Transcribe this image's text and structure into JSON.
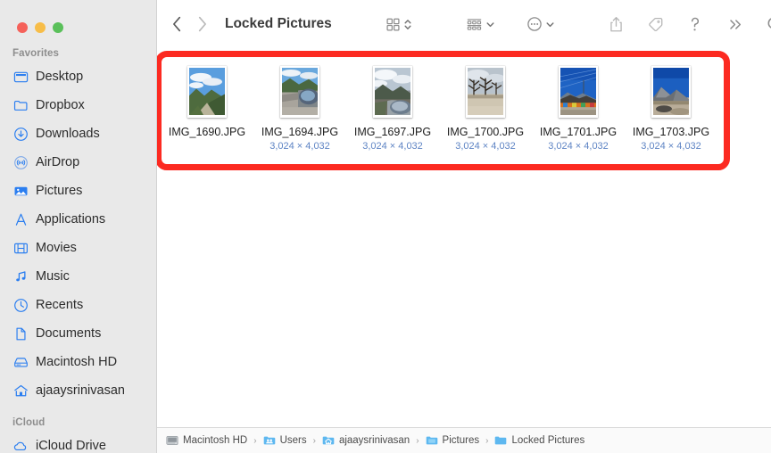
{
  "window": {
    "title": "Locked Pictures",
    "traffic_lights": [
      {
        "name": "close",
        "color": "#f5615a"
      },
      {
        "name": "minimize",
        "color": "#f7bd48"
      },
      {
        "name": "maximize",
        "color": "#5ac05a"
      }
    ]
  },
  "toolbar": {
    "back_icon": "chevron-left-icon",
    "forward_icon": "chevron-right-icon",
    "view_mode_icon": "icon-view-icon",
    "view_mode_chevron": "chevron-updown-icon",
    "group_by_icon": "group-by-icon",
    "group_by_chevron": "chevron-down-icon",
    "action_icon": "ellipsis-circle-icon",
    "action_chevron": "chevron-down-icon",
    "share_icon": "share-icon",
    "tag_icon": "tag-icon",
    "help_icon": "question-mark-icon",
    "more_icon": "double-chevron-right-icon",
    "search_icon": "search-icon"
  },
  "sidebar": {
    "sections": [
      {
        "title": "Favorites",
        "items": [
          {
            "label": "Desktop",
            "icon": "desktop-icon"
          },
          {
            "label": "Dropbox",
            "icon": "folder-icon"
          },
          {
            "label": "Downloads",
            "icon": "download-circle-icon"
          },
          {
            "label": "AirDrop",
            "icon": "airdrop-icon"
          },
          {
            "label": "Pictures",
            "icon": "pictures-icon"
          },
          {
            "label": "Applications",
            "icon": "applications-icon"
          },
          {
            "label": "Movies",
            "icon": "movies-icon"
          },
          {
            "label": "Music",
            "icon": "music-note-icon"
          },
          {
            "label": "Recents",
            "icon": "clock-icon"
          },
          {
            "label": "Documents",
            "icon": "document-icon"
          },
          {
            "label": "Macintosh HD",
            "icon": "harddisk-icon"
          },
          {
            "label": "ajaaysrinivasan",
            "icon": "home-icon"
          }
        ]
      },
      {
        "title": "iCloud",
        "items": [
          {
            "label": "iCloud Drive",
            "icon": "cloud-icon"
          }
        ]
      }
    ]
  },
  "files": [
    {
      "name": "IMG_1690.JPG",
      "dimensions": ""
    },
    {
      "name": "IMG_1694.JPG",
      "dimensions": "3,024 × 4,032"
    },
    {
      "name": "IMG_1697.JPG",
      "dimensions": "3,024 × 4,032"
    },
    {
      "name": "IMG_1700.JPG",
      "dimensions": "3,024 × 4,032"
    },
    {
      "name": "IMG_1701.JPG",
      "dimensions": "3,024 × 4,032"
    },
    {
      "name": "IMG_1703.JPG",
      "dimensions": "3,024 × 4,032"
    }
  ],
  "annotation": {
    "color": "#fc2a21",
    "shape": "rounded-rectangle"
  },
  "pathbar": {
    "crumbs": [
      {
        "label": "Macintosh HD",
        "icon": "harddisk-icon"
      },
      {
        "label": "Users",
        "icon": "folder-users-icon"
      },
      {
        "label": "ajaaysrinivasan",
        "icon": "folder-home-icon"
      },
      {
        "label": "Pictures",
        "icon": "folder-icon"
      },
      {
        "label": "Locked Pictures",
        "icon": "folder-icon"
      }
    ],
    "separator": "›"
  }
}
